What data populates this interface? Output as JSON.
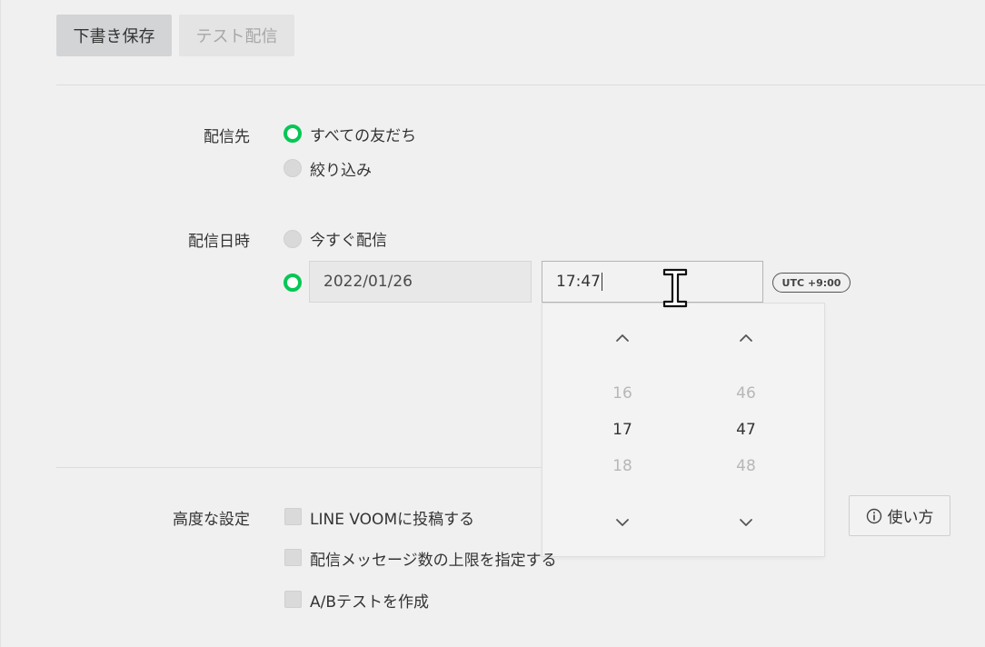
{
  "toolbar": {
    "save_draft_label": "下書き保存",
    "test_send_label": "テスト配信"
  },
  "recipients": {
    "label": "配信先",
    "options": [
      {
        "label": "すべての友だち",
        "selected": true
      },
      {
        "label": "絞り込み",
        "selected": false
      }
    ]
  },
  "schedule": {
    "label": "配信日時",
    "options": [
      {
        "label": "今すぐ配信",
        "selected": false
      },
      {
        "label": "",
        "selected": true
      }
    ],
    "date_value": "2022/01/26",
    "time_value": "17:47",
    "timezone_badge": "UTC +9:00"
  },
  "time_picker": {
    "hours": {
      "prev": "16",
      "current": "17",
      "next": "18"
    },
    "minutes": {
      "prev": "46",
      "current": "47",
      "next": "48"
    }
  },
  "advanced": {
    "label": "高度な設定",
    "options": [
      {
        "label": "LINE VOOMに投稿する",
        "checked": false
      },
      {
        "label": "配信メッセージ数の上限を指定する",
        "checked": false
      },
      {
        "label": "A/Bテストを作成",
        "checked": false
      }
    ],
    "help_label": "使い方"
  },
  "colors": {
    "accent_green": "#06c755",
    "background": "#f0f0f0"
  },
  "icons": {
    "up": "chevron-up-icon",
    "down": "chevron-down-icon",
    "info": "info-icon",
    "cursor": "text-cursor-icon"
  }
}
